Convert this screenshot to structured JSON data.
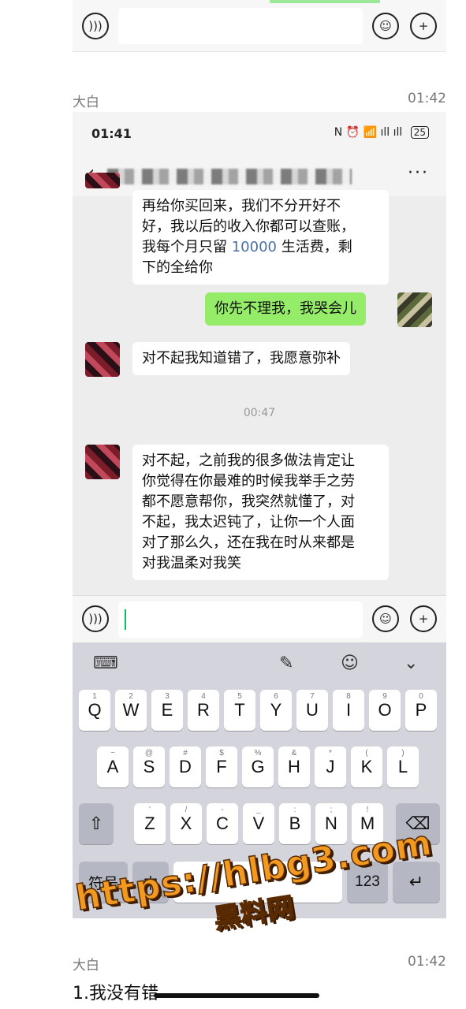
{
  "post_top": {
    "author": "大白",
    "time": "01:42"
  },
  "shot": {
    "status": {
      "clock": "01:41",
      "icons": "N ⏰ 📶 ıll ıll",
      "battery": "25"
    },
    "chat_title": "",
    "messages": [
      {
        "side": "other",
        "lines": [
          "再给你买回来，我们不分开好不",
          "好，我以后的收入你都可以查账，",
          "我每个月只留"
        ],
        "number": "10000",
        "after_number": " 生活费，剩",
        "last_line": "下的全给你"
      },
      {
        "side": "me",
        "text": "你先不理我，我哭会儿"
      },
      {
        "side": "other",
        "text": "对不起我知道错了，我愿意弥补"
      },
      {
        "side": "time",
        "text": "00:47"
      },
      {
        "side": "other",
        "lines": [
          "对不起，之前我的很多做法肯定让",
          "你觉得在你最难的时候我举手之劳",
          "都不愿意帮你，我突然就懂了，对",
          "不起，我太迟钝了，让你一个人面",
          "对了那么久，还在我在时从来都是",
          "对我温柔对我笑"
        ]
      }
    ],
    "keyboard": {
      "row1": [
        {
          "k": "Q",
          "s": "1"
        },
        {
          "k": "W",
          "s": "2"
        },
        {
          "k": "E",
          "s": "3"
        },
        {
          "k": "R",
          "s": "4"
        },
        {
          "k": "T",
          "s": "5"
        },
        {
          "k": "Y",
          "s": "6"
        },
        {
          "k": "U",
          "s": "7"
        },
        {
          "k": "I",
          "s": "8"
        },
        {
          "k": "O",
          "s": "9"
        },
        {
          "k": "P",
          "s": "0"
        }
      ],
      "row2": [
        {
          "k": "A",
          "s": "~"
        },
        {
          "k": "S",
          "s": "@"
        },
        {
          "k": "D",
          "s": "#"
        },
        {
          "k": "F",
          "s": "$"
        },
        {
          "k": "G",
          "s": "%"
        },
        {
          "k": "H",
          "s": "&"
        },
        {
          "k": "J",
          "s": "*"
        },
        {
          "k": "K",
          "s": "("
        },
        {
          "k": "L",
          "s": ")"
        }
      ],
      "row3": [
        {
          "k": "Z",
          "s": "'"
        },
        {
          "k": "X",
          "s": "/"
        },
        {
          "k": "C",
          "s": "-"
        },
        {
          "k": "V",
          "s": "_"
        },
        {
          "k": "B",
          "s": ":"
        },
        {
          "k": "N",
          "s": ";"
        },
        {
          "k": "M",
          "s": "!"
        }
      ],
      "symbols_key": "符号",
      "lang_key": "中",
      "lang_sub": "英",
      "num_key": "123",
      "shift": "⇧",
      "backspace": "⌫",
      "enter": "↵"
    }
  },
  "watermark": {
    "url": "https://hlbg3.com",
    "name": "黑料网"
  },
  "post_bottom": {
    "author": "大白",
    "time": "01:42",
    "text": "1.我没有错"
  }
}
